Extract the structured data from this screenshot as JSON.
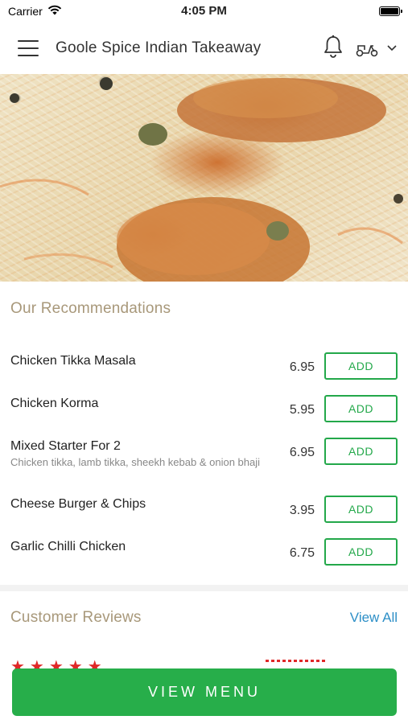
{
  "status_bar": {
    "carrier": "Carrier",
    "time": "4:05 PM"
  },
  "header": {
    "title": "Goole Spice Indian Takeaway"
  },
  "icons": {
    "menu": "hamburger-menu-icon",
    "bell": "bell-icon",
    "scooter": "scooter-icon",
    "chevron": "chevron-down-icon"
  },
  "recommendations": {
    "title": "Our Recommendations",
    "items": [
      {
        "name": "Chicken Tikka Masala",
        "description": "",
        "price": "6.95",
        "button": "ADD"
      },
      {
        "name": "Chicken Korma",
        "description": "",
        "price": "5.95",
        "button": "ADD"
      },
      {
        "name": "Mixed Starter For 2",
        "description": "Chicken tikka, lamb tikka, sheekh kebab & onion bhaji",
        "price": "6.95",
        "button": "ADD"
      },
      {
        "name": "Cheese Burger & Chips",
        "description": "",
        "price": "3.95",
        "button": "ADD"
      },
      {
        "name": "Garlic Chilli Chicken",
        "description": "",
        "price": "6.75",
        "button": "ADD"
      }
    ]
  },
  "reviews": {
    "title": "Customer Reviews",
    "view_all": "View All"
  },
  "cta": {
    "label": "VIEW MENU"
  },
  "colors": {
    "accent_green": "#27ae4a",
    "link_blue": "#2d8fc7",
    "section_title": "#a8987a"
  }
}
